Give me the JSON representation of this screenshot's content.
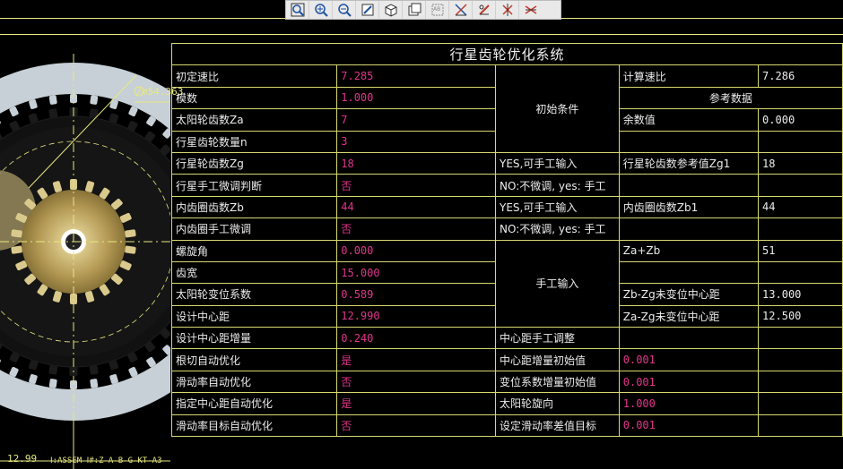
{
  "toolbar": {
    "icons": [
      "zoom-window-icon",
      "zoom-in-icon",
      "zoom-out-icon",
      "repaint-icon",
      "orient-icon",
      "view-list-icon",
      "datum-axes-icon",
      "sketch-icon",
      "datum-csys-icon",
      "datum-points-icon",
      "spin-center-icon"
    ]
  },
  "drawing": {
    "dim_diameter": "∅54.363",
    "dim_bottom": "12.99",
    "status": "Ⅰ:ASSEM  Ⅰ#:Z-A-B-G-KT-A3"
  },
  "table": {
    "title": "行星齿轮优化系统",
    "rows": [
      {
        "label": "初定速比",
        "value": "7.285"
      },
      {
        "label": "模数",
        "value": "1.000"
      },
      {
        "label": "太阳轮齿数Za",
        "value": "7"
      },
      {
        "label": "行星齿轮数量n",
        "value": "3"
      },
      {
        "label": "行星轮齿数Zg",
        "value": "18"
      },
      {
        "label": "行星手工微调判断",
        "value": "否"
      },
      {
        "label": "内齿圈齿数Zb",
        "value": "44"
      },
      {
        "label": "内齿圈手工微调",
        "value": "否"
      },
      {
        "label": "螺旋角",
        "value": "0.000"
      },
      {
        "label": "齿宽",
        "value": "15.000"
      },
      {
        "label": "太阳轮变位系数",
        "value": "0.589"
      },
      {
        "label": "设计中心距",
        "value": "12.990"
      },
      {
        "label": "设计中心距增量",
        "value": "0.240"
      },
      {
        "label": "根切自动优化",
        "value": "是"
      },
      {
        "label": "滑动率自动优化",
        "value": "否"
      },
      {
        "label": "指定中心距自动优化",
        "value": "是"
      },
      {
        "label": "滑动率目标自动优化",
        "value": "否"
      }
    ],
    "col3": {
      "initial_conditions": "初始条件",
      "r5": "YES,可手工输入",
      "r6": "NO:不微调, yes: 手工",
      "r7": "YES,可手工输入",
      "r8": "NO:不微调, yes: 手工",
      "manual_input": "手工输入",
      "r13": "中心距手工调整",
      "r14": "中心距增量初始值",
      "r15": "变位系数增量初始值",
      "r16": "太阳轮旋向",
      "r17": "设定滑动率差值目标"
    },
    "col4": {
      "r1": "计算速比",
      "ref_data": "参考数据",
      "r3": "余数值",
      "r5": "行星轮齿数参考值Zg1",
      "r7": "内齿圈齿数Zb1",
      "r9": "Za+Zb",
      "r11": "Zb-Zg未变位中心距",
      "r12": "Za-Zg未变位中心距",
      "r14": "0.001",
      "r15": "0.001",
      "r16": "1.000",
      "r17": "0.001"
    },
    "col5": {
      "r1": "7.286",
      "r3": "0.000",
      "r5": "18",
      "r7": "44",
      "r9": "51",
      "r11": "13.000",
      "r12": "12.500"
    }
  }
}
